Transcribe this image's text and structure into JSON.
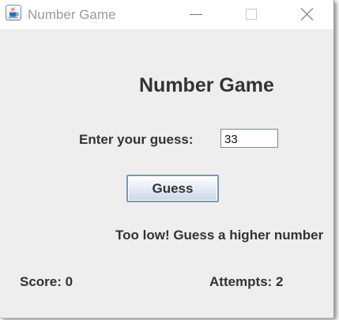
{
  "window": {
    "title": "Number Game",
    "icon": "java-coffee-cup-icon",
    "controls": {
      "minimize_icon": "minimize-icon",
      "maximize_icon": "maximize-icon",
      "close_icon": "close-icon"
    }
  },
  "game": {
    "heading": "Number Game",
    "guess_label": "Enter your guess:",
    "guess_value": "33",
    "guess_button_label": "Guess",
    "result_message": "Too low! Guess a higher number",
    "score_text": "Score: 0",
    "attempts_text": "Attempts: 2"
  },
  "colors": {
    "window_background": "#eeeeee",
    "text": "#333333",
    "button_border": "#7a98bc"
  }
}
